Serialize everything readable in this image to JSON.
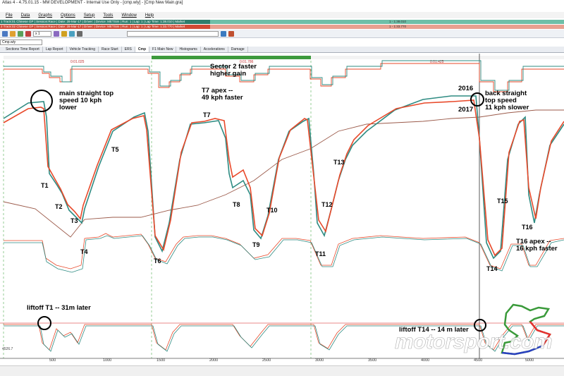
{
  "window": {
    "title": "Atlas 4 - 4.75.01.15 - MM DEVELOPMENT - Internal Use Only - [cmp.wly] - [Cmp New Main.gra]"
  },
  "menu": [
    "File",
    "Data",
    "Graphs",
    "Options",
    "Setup",
    "Tools",
    "Window",
    "Help"
  ],
  "sessions": [
    {
      "label": "1 Track:01 Chinese GP | Session:Race | Date: 28-Mar-17 | Driver: | Device: METSim | Run: 1 | Lap: 1 | Lap Time: 1:38.010 | Market",
      "time": "1 - 1:38.010",
      "color": "#2e7d6c"
    },
    {
      "label": "2 Track:02 Chinese GP | Session:Race | Date: 28-Mar-17 | Driver: | Device: METSim | Run: 1 | Lap: 1 | Lap Time: 1:33.770 | Market",
      "time": "1 - 1:33.770",
      "color": "#d04a35"
    }
  ],
  "toolbar": {
    "zoom": "x 1",
    "file": "Cmp.wly",
    "file_short": "ula-1"
  },
  "tabs": [
    "Sections Time Report",
    "Lap Report",
    "Vehicle Tracking",
    "Race Start",
    "ERS",
    "Cmp",
    "F1 Main New",
    "Histograms",
    "Accelerations",
    "Damage"
  ],
  "active_tab": "Cmp",
  "sector_labels": {
    "s1": "0:01.025",
    "s2": "0:01.786",
    "s3": "0:01.425"
  },
  "annotations": {
    "main_straight": "main straight top\nspeed 10 kph\nlower",
    "sector2": "Sector 2 faster\nhigher gain",
    "t7_apex": "T7 apex --\n49 kph faster",
    "year_2016": "2016",
    "year_2017": "2017",
    "back_straight": "back straight\ntop speed\n11 kph slower",
    "t16_apex": "T16 apex --\n16 kph faster",
    "liftoff_t1": "liftoff T1 -- 31m later",
    "liftoff_t14": "liftoff T14 -- 14 m later"
  },
  "turns": [
    "T1",
    "T2",
    "T3",
    "T4",
    "T5",
    "T6",
    "T7",
    "T8",
    "T9",
    "T10",
    "T11",
    "T12",
    "T13",
    "T14",
    "T15",
    "T16"
  ],
  "x_ticks": [
    "500",
    "1000",
    "1500",
    "2000",
    "2500",
    "3000",
    "3500",
    "4000",
    "4500",
    "5000"
  ],
  "y_readout": "4526.7",
  "watermark": "motorsport.com",
  "colors": {
    "teal": "#2e8b82",
    "red": "#e8492a",
    "brown": "#9b5a4a",
    "green_band": "#3d9a3d",
    "red_grid": "#e06060"
  }
}
